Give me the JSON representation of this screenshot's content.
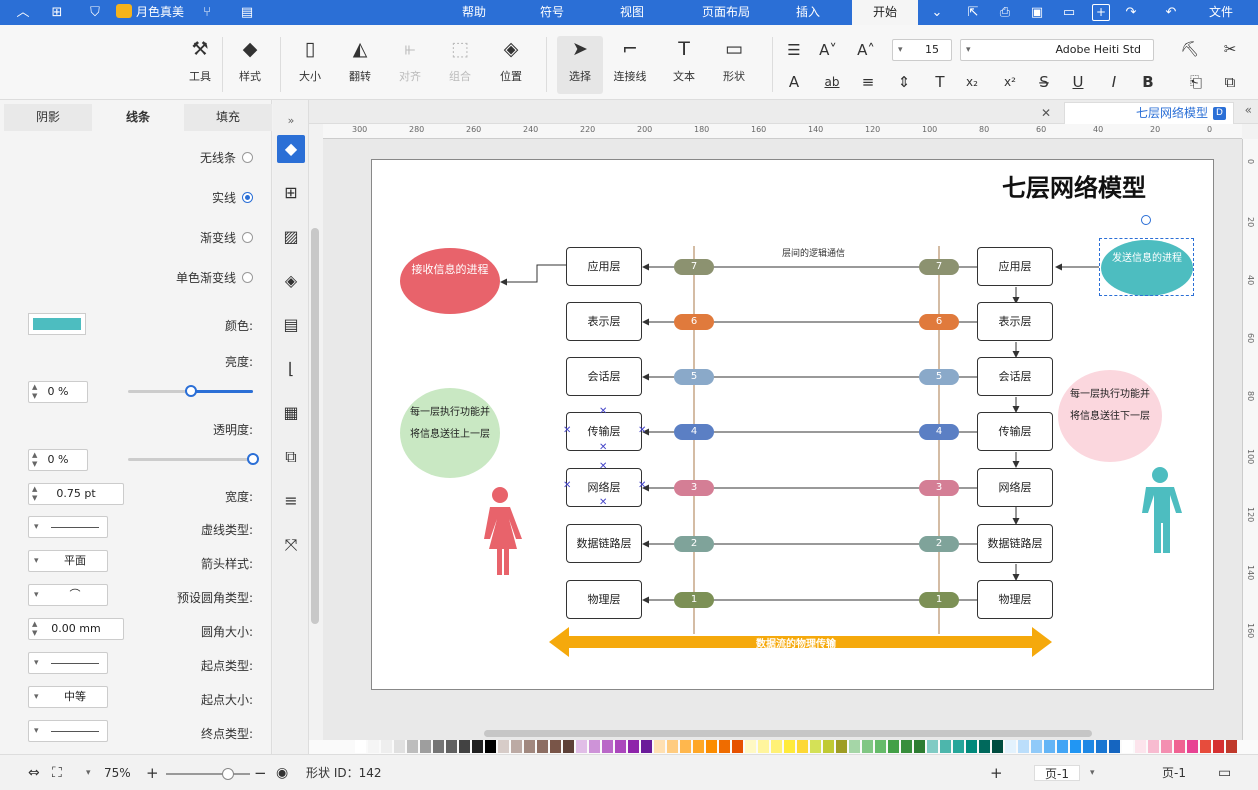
{
  "menubar": {
    "items": [
      "文件",
      "开始",
      "插入",
      "页面布局",
      "视图",
      "符号",
      "帮助"
    ],
    "active": "开始",
    "user": "月色真美"
  },
  "ribbon": {
    "font_name": "Adobe Heiti Std",
    "font_size": "15",
    "buttons": {
      "shape": "形状",
      "text": "文本",
      "connector": "连接线",
      "select": "选择",
      "position": "位置",
      "group": "组合",
      "align": "对齐",
      "rotate": "翻转",
      "size": "大小",
      "style": "样式",
      "tools": "工具"
    }
  },
  "panel": {
    "tabs": [
      "填充",
      "线条",
      "阴影"
    ],
    "active_tab": "线条",
    "line_options": [
      "无线条",
      "实线",
      "渐变线",
      "单色渐变线"
    ],
    "selected_option": "实线",
    "color_label": "颜色:",
    "color_value": "#4dbdc0",
    "brightness_label": "亮度:",
    "brightness_value": "0 %",
    "brightness_level": 0.5,
    "transparency_label": "透明度:",
    "transparency_value": "0 %",
    "transparency_level": 0,
    "width_label": "宽度:",
    "width_value": "0.75 pt",
    "dash_label": "虚线类型:",
    "arrow_style_label": "箭头样式:",
    "arrow_style_value": "平面",
    "corner_type_label": "预设圆角类型:",
    "corner_size_label": "圆角大小:",
    "corner_size_value": "0.00 mm",
    "start_type_label": "起点类型:",
    "start_size_label": "起点大小:",
    "start_size_value": "中等",
    "end_type_label": "终点类型:"
  },
  "document": {
    "tab_title": "七层网络模型"
  },
  "ruler": {
    "h_ticks": [
      "0",
      "20",
      "40",
      "60",
      "80",
      "100",
      "120",
      "140",
      "160",
      "180",
      "200",
      "220",
      "240",
      "260",
      "280",
      "300"
    ],
    "v_ticks": [
      "0",
      "20",
      "40",
      "60",
      "80",
      "100",
      "120",
      "140",
      "160"
    ]
  },
  "diagram": {
    "title": "七层网络模型",
    "right_layers": [
      "应用层",
      "表示层",
      "会话层",
      "传输层",
      "网络层",
      "数据链路层",
      "物理层"
    ],
    "left_layers": [
      "应用层",
      "表示层",
      "会话层",
      "传输层",
      "网络层",
      "数据链路层",
      "物理层"
    ],
    "pill_numbers": [
      "7",
      "6",
      "5",
      "4",
      "3",
      "2",
      "1"
    ],
    "pill_colors": [
      "#8c9270",
      "#e07a3c",
      "#8aa9c9",
      "#5b7fc4",
      "#d47e95",
      "#7fa39a",
      "#7c9055"
    ],
    "logic_label": "层间的逻辑通信",
    "physical_label": "数据流的物理传输",
    "sender_bubble": "发送信息的进程",
    "receiver_bubble": "接收信息的进程",
    "right_note": "每一层执行功能并将信息送往下一层",
    "left_note": "每一层执行功能并将信息送往上一层"
  },
  "palette_colors": [
    "#c0392b",
    "#d63031",
    "#e74c3c",
    "#e84393",
    "#f06292",
    "#f48fb1",
    "#f8bbd0",
    "#fce4ec",
    "#ffffff",
    "#1565c0",
    "#1976d2",
    "#1e88e5",
    "#2196f3",
    "#42a5f5",
    "#64b5f6",
    "#90caf9",
    "#bbdefb",
    "#e3f2fd",
    "#004d40",
    "#00695c",
    "#00897b",
    "#26a69a",
    "#4db6ac",
    "#80cbc4",
    "#2e7d32",
    "#388e3c",
    "#43a047",
    "#66bb6a",
    "#81c784",
    "#a5d6a7",
    "#9e9d24",
    "#c0ca33",
    "#d4e157",
    "#fdd835",
    "#ffeb3b",
    "#fff176",
    "#fff59d",
    "#fff9c4",
    "#e65100",
    "#ef6c00",
    "#fb8c00",
    "#ffa726",
    "#ffb74d",
    "#ffcc80",
    "#ffe0b2",
    "#6a1b9a",
    "#8e24aa",
    "#ab47bc",
    "#ba68c8",
    "#ce93d8",
    "#e1bee7",
    "#5d4037",
    "#795548",
    "#8d6e63",
    "#a1887f",
    "#bcaaa4",
    "#d7ccc8",
    "#000000",
    "#212121",
    "#424242",
    "#616161",
    "#757575",
    "#9e9e9e",
    "#bdbdbd",
    "#e0e0e0",
    "#eeeeee",
    "#f5f5f5",
    "#ffffff"
  ],
  "statusbar": {
    "page_label": "页-1",
    "page_tab": "页-1",
    "shape_id": "形状 ID：142",
    "zoom": "75%"
  }
}
